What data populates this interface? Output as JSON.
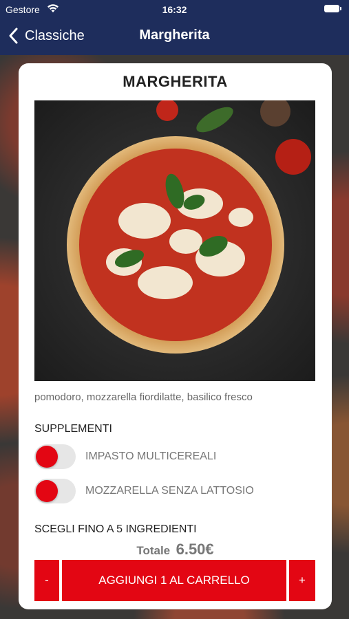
{
  "status_bar": {
    "carrier": "Gestore",
    "time": "16:32"
  },
  "nav": {
    "back_label": "Classiche",
    "title": "Margherita"
  },
  "product": {
    "name": "MARGHERITA",
    "description": "pomodoro, mozzarella fiordilatte, basilico fresco"
  },
  "supplements": {
    "title": "SUPPLEMENTI",
    "items": [
      {
        "label": "IMPASTO MULTICEREALI",
        "enabled": false
      },
      {
        "label": "MOZZARELLA SENZA LATTOSIO",
        "enabled": false
      }
    ]
  },
  "ingredients": {
    "title": "SCEGLI FINO A 5 INGREDIENTI"
  },
  "total": {
    "label": "Totale",
    "value": "6.50€"
  },
  "actions": {
    "minus": "-",
    "add_to_cart": "AGGIUNGI 1 AL CARRELLO",
    "plus": "+"
  },
  "colors": {
    "nav_bar": "#1e2d5c",
    "accent": "#e30613"
  }
}
